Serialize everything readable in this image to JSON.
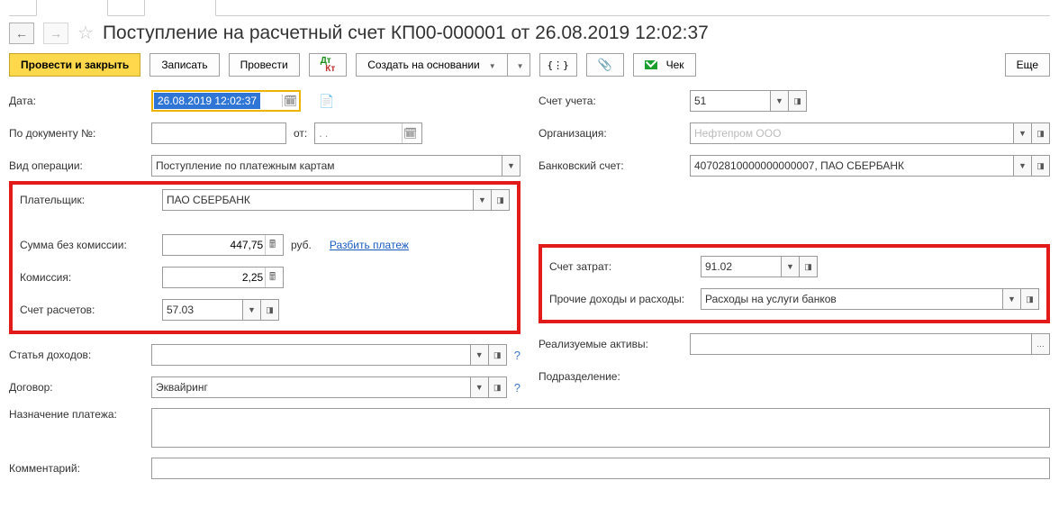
{
  "title": "Поступление на расчетный счет КП00-000001 от 26.08.2019 12:02:37",
  "toolbar": {
    "post_close": "Провести и закрыть",
    "save": "Записать",
    "post": "Провести",
    "create_based": "Создать на основании",
    "check": "Чек",
    "more": "Еще"
  },
  "labels": {
    "date": "Дата:",
    "doc_no": "По документу №:",
    "from": "от:",
    "op_type": "Вид операции:",
    "payer": "Плательщик:",
    "sum_no_fee": "Сумма без комиссии:",
    "fee": "Комиссия:",
    "settle_acc": "Счет расчетов:",
    "income_art": "Статья доходов:",
    "contract": "Договор:",
    "purpose": "Назначение платежа:",
    "comment": "Комментарий:",
    "ledger": "Счет учета:",
    "org": "Организация:",
    "bank_acc": "Банковский счет:",
    "cost_acc": "Счет затрат:",
    "other_inc_exp": "Прочие доходы и расходы:",
    "realized_assets": "Реализуемые активы:",
    "division": "Подразделение:"
  },
  "values": {
    "date": "26.08.2019 12:02:37",
    "doc_no": "",
    "doc_date": ".   .",
    "op_type": "Поступление по платежным картам",
    "payer": "ПАО СБЕРБАНК",
    "sum_no_fee": "447,75",
    "fee": "2,25",
    "settle_acc": "57.03",
    "income_art": "",
    "contract": "Эквайринг",
    "purpose": "",
    "comment": "",
    "ledger": "51",
    "org": "Нефтепром ООО",
    "bank_acc": "40702810000000000007, ПАО СБЕРБАНК",
    "cost_acc": "91.02",
    "other_inc_exp": "Расходы на услуги банков",
    "realized_assets": "",
    "division": ""
  },
  "misc": {
    "currency": "руб.",
    "split_payment": "Разбить платеж"
  }
}
